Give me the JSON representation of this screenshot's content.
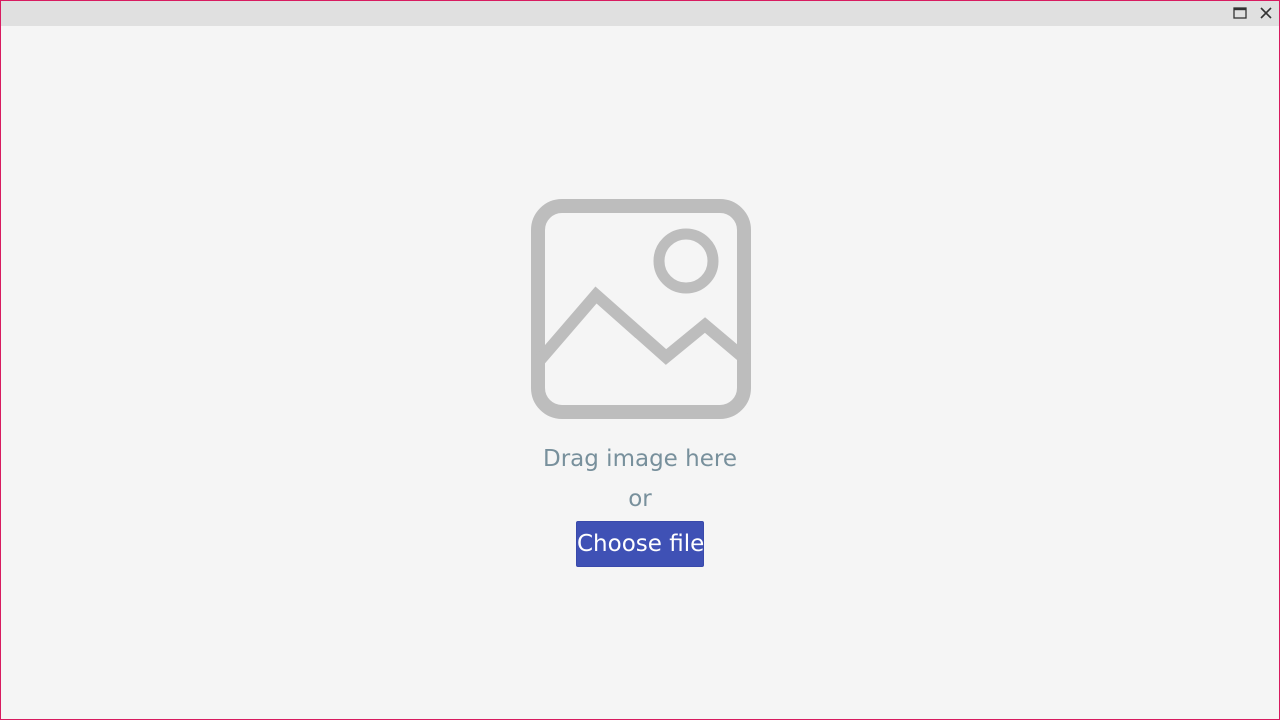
{
  "window": {
    "frame_color": "#d81b60",
    "titlebar_color": "#e0e0e0",
    "background_color": "#f5f5f5",
    "controls": {
      "maximize_icon": "maximize-icon",
      "close_icon": "close-icon"
    }
  },
  "dropzone": {
    "placeholder_icon": "image-placeholder-icon",
    "icon_color": "#bdbdbd",
    "drag_text": "Drag image here",
    "or_text": "or",
    "choose_button_label": "Choose file",
    "text_color": "#78909c",
    "button_color": "#3f51b5"
  }
}
